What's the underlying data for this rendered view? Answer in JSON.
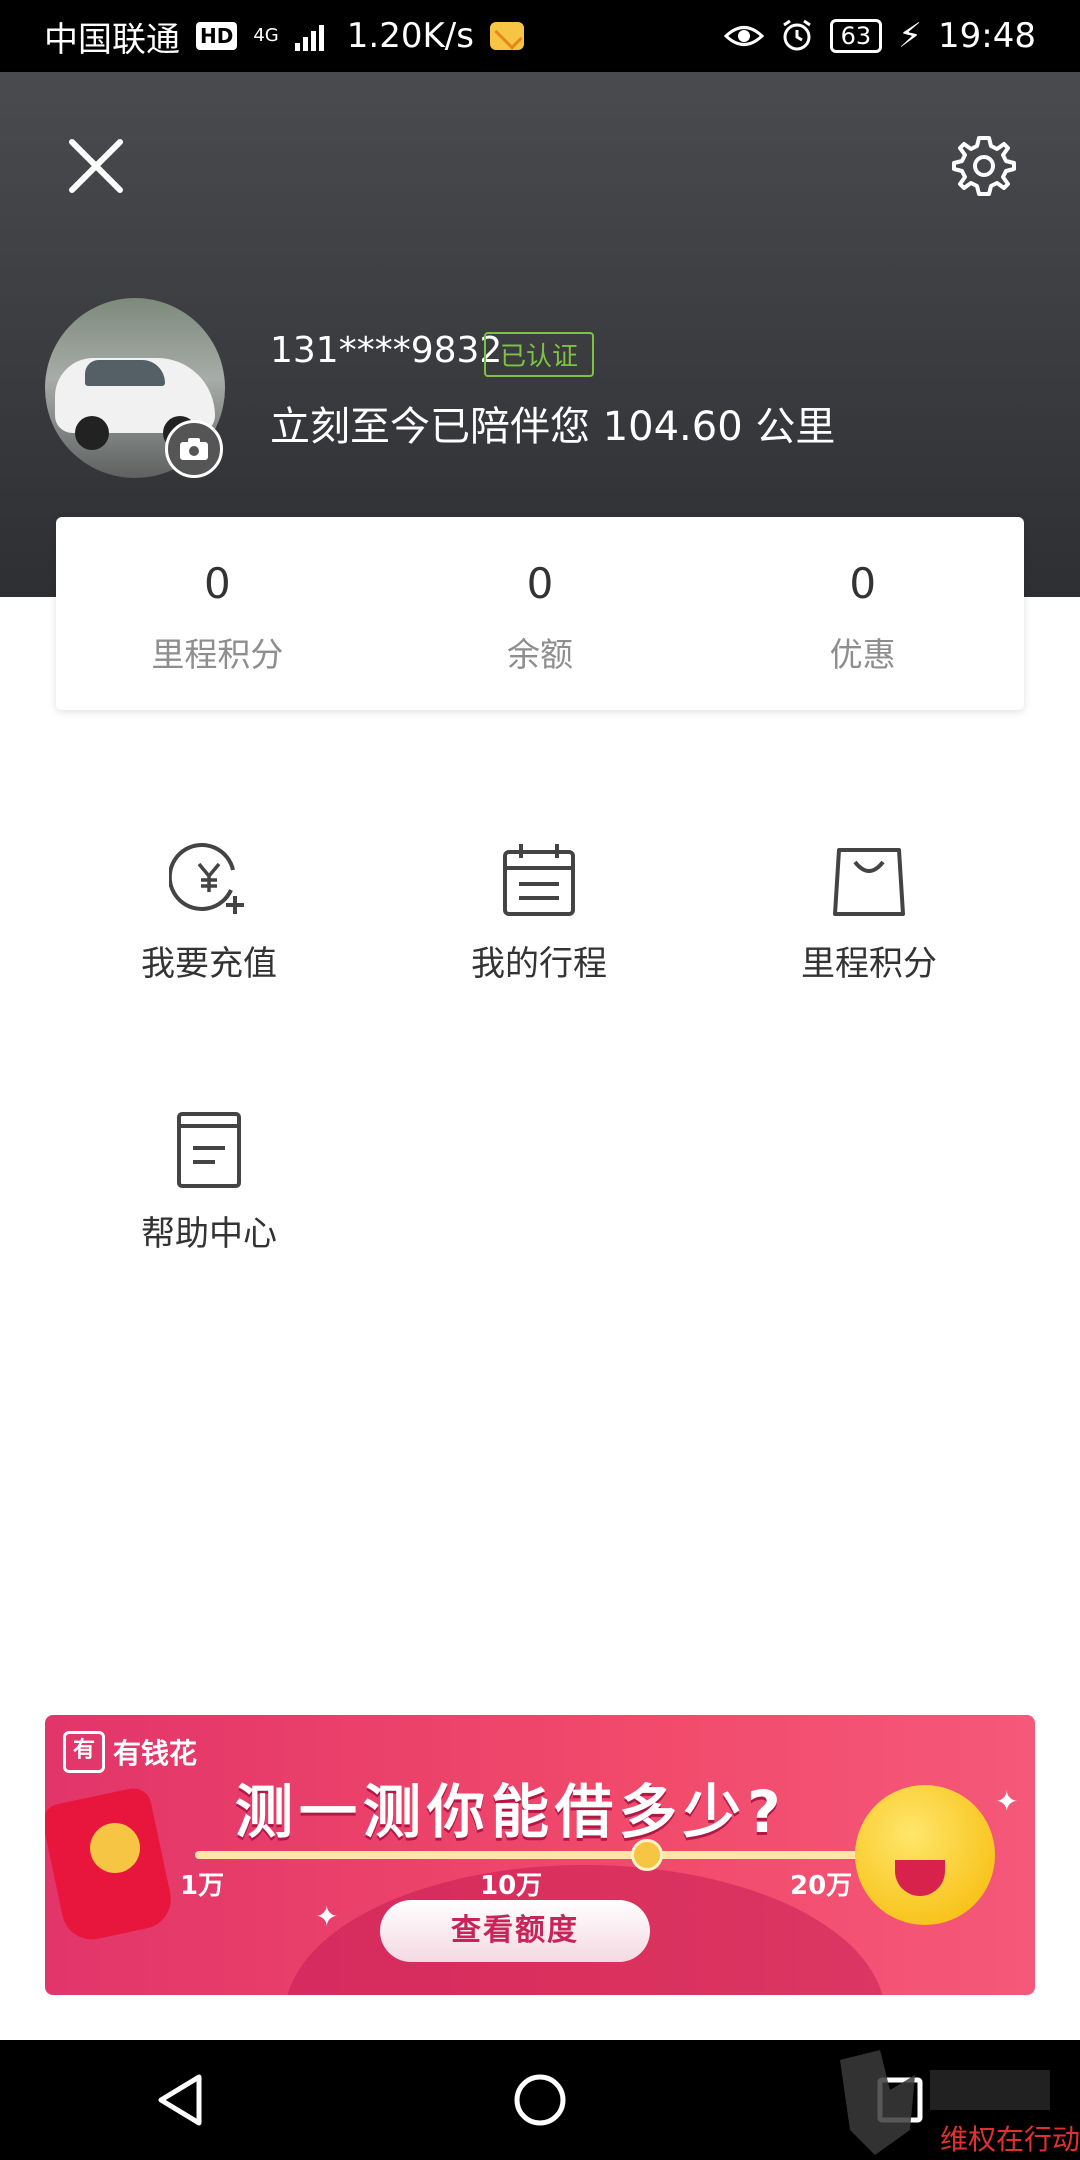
{
  "status_bar": {
    "carrier": "中国联通",
    "hd_badge": "HD",
    "network": "4G",
    "speed": "1.20K/s",
    "battery": "63",
    "time": "19:48"
  },
  "header": {
    "phone": "131****9832",
    "verified_label": "已认证",
    "mileage_text": "立刻至今已陪伴您 104.60 公里"
  },
  "stats": [
    {
      "value": "0",
      "label": "里程积分"
    },
    {
      "value": "0",
      "label": "余额"
    },
    {
      "value": "0",
      "label": "优惠"
    }
  ],
  "menu": [
    {
      "label": "我要充值",
      "icon": "recharge-icon"
    },
    {
      "label": "我的行程",
      "icon": "calendar-icon"
    },
    {
      "label": "里程积分",
      "icon": "shopping-bag-icon"
    },
    {
      "label": "帮助中心",
      "icon": "document-icon"
    }
  ],
  "banner": {
    "brand": "有钱花",
    "title": "测一测你能借多少?",
    "ticks": [
      "1万",
      "10万",
      "20万"
    ],
    "button_label": "查看额度"
  },
  "watermark": {
    "text": "维权在行动"
  },
  "colors": {
    "header_bg": "#3a3b3f",
    "verified_green": "#7dc242",
    "banner_pink": "#e2356a"
  }
}
